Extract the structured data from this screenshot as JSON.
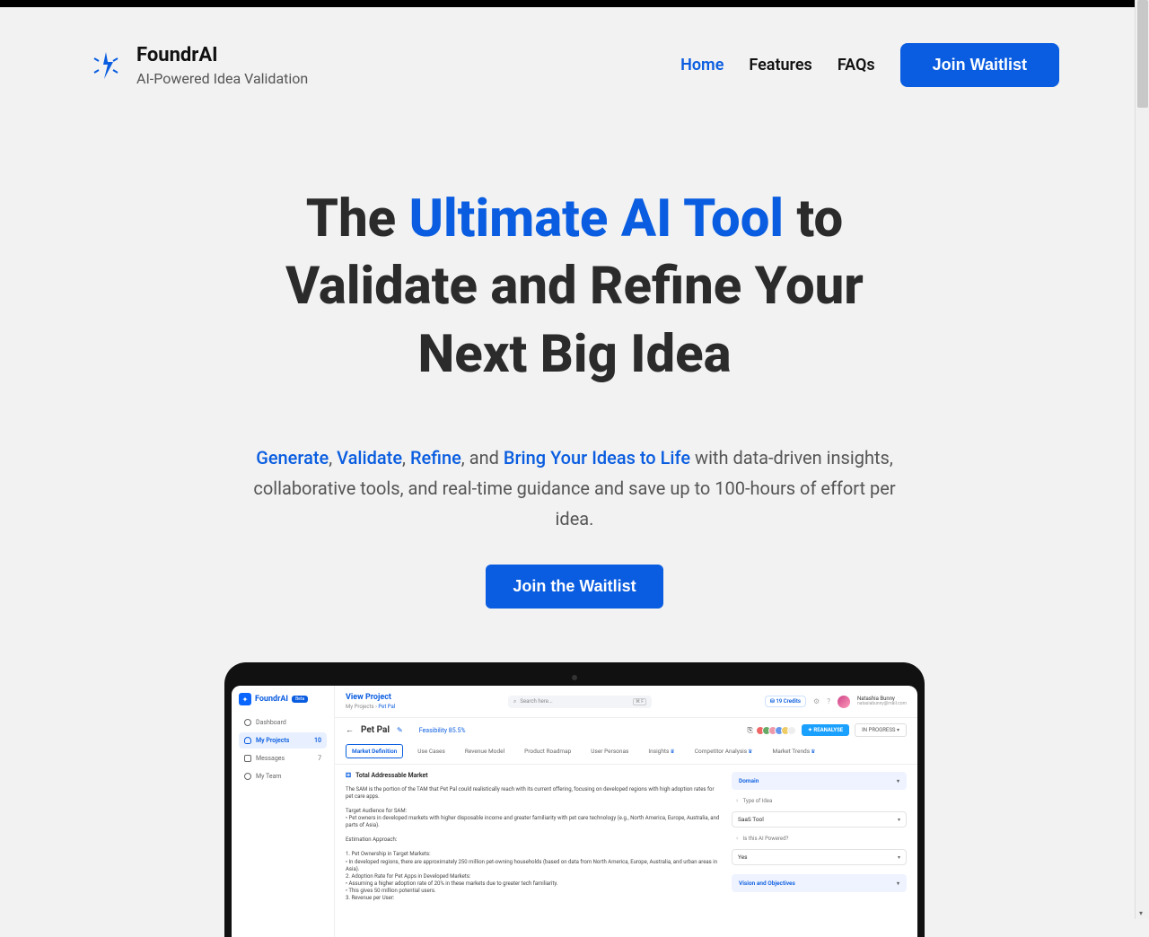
{
  "brand": {
    "name": "FoundrAI",
    "tagline": "AI-Powered Idea Validation"
  },
  "nav": {
    "home": "Home",
    "features": "Features",
    "faqs": "FAQs",
    "join": "Join Waitlist"
  },
  "hero": {
    "pre": "The ",
    "accent": "Ultimate AI Tool",
    "post": " to Validate and Refine Your Next Big Idea",
    "sub_generate": "Generate",
    "sub_validate": "Validate",
    "sub_refine": "Refine",
    "sub_and": ", and ",
    "sub_bring": "Bring Your Ideas to Life",
    "sub_rest": " with data-driven insights, collaborative tools, and real-time guidance and save up to 100-hours of effort per idea.",
    "cta": "Join the Waitlist"
  },
  "mock": {
    "logo": "FoundrAI",
    "beta": "Beta",
    "sidebar": {
      "dashboard": "Dashboard",
      "projects": "My Projects",
      "projects_count": "10",
      "messages": "Messages",
      "messages_count": "7",
      "team": "My Team"
    },
    "topbar": {
      "title": "View Project",
      "crumb_root": "My Projects",
      "crumb_sep": "›",
      "crumb_current": "Pet Pal",
      "search_placeholder": "Search here...",
      "search_kbd": "⌘ F",
      "credits": "19 Credits",
      "user_name": "Natashia Bunny",
      "user_email": "natasiabunny@mail.com"
    },
    "titlebar": {
      "back": "←",
      "project": "Pet Pal",
      "feasibility": "Feasibility 85.5%",
      "reanalyse": "✦ REANALYSE",
      "status": "IN PROGRESS"
    },
    "tabs": {
      "market": "Market Definition",
      "usecases": "Use Cases",
      "revenue": "Revenue Model",
      "roadmap": "Product Roadmap",
      "personas": "User Personas",
      "insights": "Insights",
      "competitor": "Competitor Analysis",
      "trends": "Market Trends"
    },
    "content": {
      "header": "Total Addressable Market",
      "p1": "The SAM is the portion of the TAM that Pet Pal could realistically reach with its current offering, focusing on developed regions with high adoption rates for pet care apps.",
      "p2": "Target Audience for SAM:",
      "p2a": "• Pet owners in developed markets with higher disposable income and greater familiarity with pet care technology (e.g., North America, Europe, Australia, and parts of Asia).",
      "p3": "Estimation Approach:",
      "l1": "1. Pet Ownership in Target Markets:",
      "l1a": "• In developed regions, there are approximately 250 million pet-owning households (based on data from North America, Europe, Australia, and urban areas in Asia).",
      "l2": "2. Adoption Rate for Pet Apps in Developed Markets:",
      "l2a": "• Assuming a higher adoption rate of 20% in these markets due to greater tech familiarity.",
      "l2b": "• This gives 50 million potential users.",
      "l3": "3. Revenue per User:"
    },
    "side": {
      "domain": "Domain",
      "type_label": "Type of Idea",
      "type_value": "SaaS Tool",
      "ai_label": "Is this AI Powered?",
      "ai_value": "Yes",
      "vision": "Vision and Objectives"
    }
  }
}
